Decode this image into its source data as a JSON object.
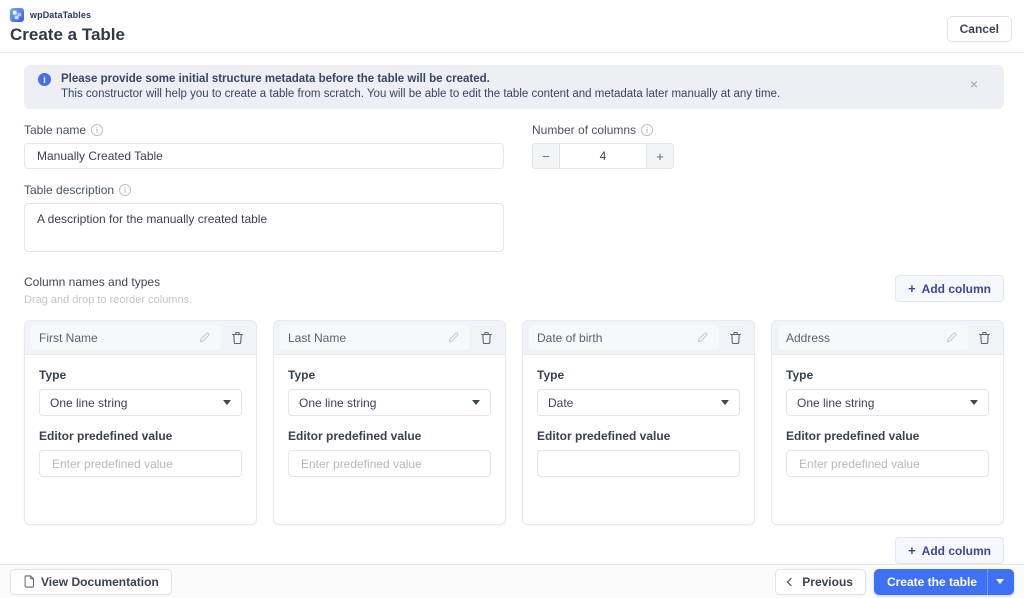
{
  "app": {
    "logo_text": "wpDataTables",
    "page_title": "Create a Table",
    "cancel_label": "Cancel"
  },
  "banner": {
    "line1": "Please provide some initial structure metadata before the table will be created.",
    "line2": "This constructor will help you to create a table from scratch. You will be able to edit the table content and metadata later manually at any time."
  },
  "form": {
    "table_name_label": "Table name",
    "table_name_value": "Manually Created Table",
    "columns_count_label": "Number of columns",
    "columns_count_value": "4",
    "description_label": "Table description",
    "description_value": "A description for the manually created table"
  },
  "columns_section": {
    "title": "Column names and types",
    "hint": "Drag and drop to reorder columns.",
    "add_column_label": "Add column"
  },
  "columns": [
    {
      "name": "First Name",
      "type_label": "Type",
      "type_value": "One line string",
      "predefined_label": "Editor predefined value",
      "predefined_placeholder": "Enter predefined value"
    },
    {
      "name": "Last Name",
      "type_label": "Type",
      "type_value": "One line string",
      "predefined_label": "Editor predefined value",
      "predefined_placeholder": "Enter predefined value"
    },
    {
      "name": "Date of birth",
      "type_label": "Type",
      "type_value": "Date",
      "predefined_label": "Editor predefined value",
      "predefined_placeholder": ""
    },
    {
      "name": "Address",
      "type_label": "Type",
      "type_value": "One line string",
      "predefined_label": "Editor predefined value",
      "predefined_placeholder": "Enter predefined value"
    }
  ],
  "footer": {
    "view_docs_label": "View Documentation",
    "previous_label": "Previous",
    "create_label": "Create the table"
  },
  "icons": {
    "plus": "+",
    "minus": "−",
    "close": "×",
    "info": "i"
  },
  "colors": {
    "accent_blue": "#4070f4",
    "indigo_link": "#3d4894",
    "banner_bg": "#edeff4",
    "info_icon_blue": "#4a6cf0"
  }
}
